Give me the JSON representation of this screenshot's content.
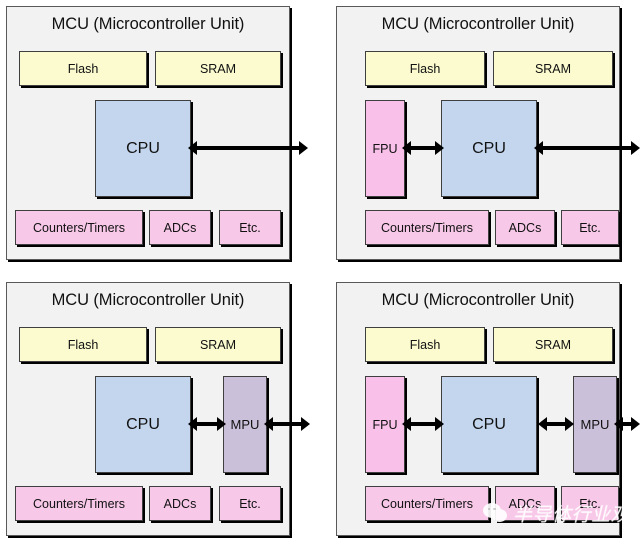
{
  "diagram": {
    "title_text": "MCU (Microcontroller Unit)",
    "colors": {
      "panel_bg": "#f2f2f2",
      "panel_border": "#595959",
      "memory_block": "#fbfbcf",
      "cpu_block": "#c3d6ee",
      "mpu_block": "#cbc0da",
      "fpu_block": "#f9c0ea",
      "peripheral_block": "#f8c8e8",
      "arrow": "#000000",
      "text": "#111111"
    },
    "panels": [
      {
        "id": "panel-basic-mcu",
        "title": "MCU (Microcontroller Unit)",
        "blocks": {
          "flash": "Flash",
          "sram": "SRAM",
          "cpu": "CPU",
          "counters_timers": "Counters/Timers",
          "adcs": "ADCs",
          "etc": "Etc."
        }
      },
      {
        "id": "panel-mcu-with-fpu",
        "title": "MCU (Microcontroller Unit)",
        "blocks": {
          "flash": "Flash",
          "sram": "SRAM",
          "fpu": "FPU",
          "cpu": "CPU",
          "counters_timers": "Counters/Timers",
          "adcs": "ADCs",
          "etc": "Etc."
        }
      },
      {
        "id": "panel-mcu-with-mpu",
        "title": "MCU (Microcontroller Unit)",
        "blocks": {
          "flash": "Flash",
          "sram": "SRAM",
          "cpu": "CPU",
          "mpu": "MPU",
          "counters_timers": "Counters/Timers",
          "adcs": "ADCs",
          "etc": "Etc."
        }
      },
      {
        "id": "panel-mcu-with-fpu-and-mpu",
        "title": "MCU (Microcontroller Unit)",
        "blocks": {
          "flash": "Flash",
          "sram": "SRAM",
          "fpu": "FPU",
          "cpu": "CPU",
          "mpu": "MPU",
          "counters_timers": "Counters/Timers",
          "adcs": "ADCs",
          "etc": "Etc."
        }
      }
    ]
  },
  "watermark": {
    "text": "半导体行业观察",
    "logo": "wechat-icon"
  }
}
